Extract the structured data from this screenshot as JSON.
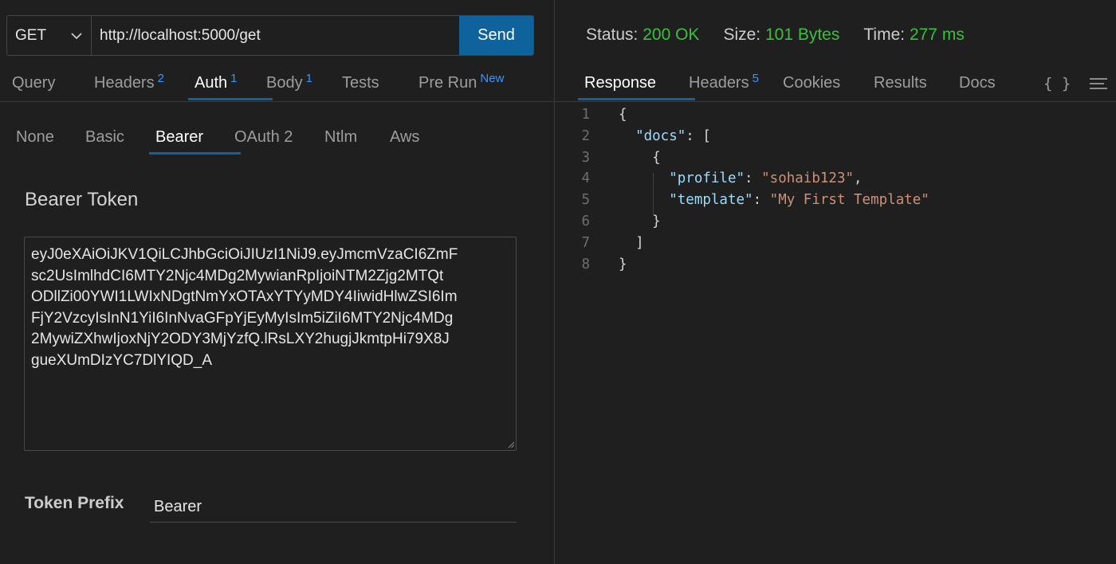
{
  "request": {
    "method": "GET",
    "url": "http://localhost:5000/get",
    "send_label": "Send"
  },
  "request_tabs": [
    {
      "label": "Query",
      "badge": ""
    },
    {
      "label": "Headers",
      "badge": "2"
    },
    {
      "label": "Auth",
      "badge": "1"
    },
    {
      "label": "Body",
      "badge": "1"
    },
    {
      "label": "Tests",
      "badge": ""
    },
    {
      "label": "Pre Run",
      "badge": "New"
    }
  ],
  "auth_tabs": [
    "None",
    "Basic",
    "Bearer",
    "OAuth 2",
    "Ntlm",
    "Aws"
  ],
  "auth": {
    "section_title": "Bearer Token",
    "token": "eyJ0eXAiOiJKV1QiLCJhbGciOiJIUzI1NiJ9.eyJmcmVzaCI6ZmFsc2UsImlhdCI6MTY2Njc4MDg2MywianRpIjoiNTM2Zjg2MTQtODllZi00YWI1LWIxNDgtNmYxOTAxYTYyMDY4IiwidHlwZSI6ImFjY2VzcyIsInN1YiI6InNvaGFpYjEyMyIsIm5iZiI6MTY2Njc4MDg2MywiZXhwIjoxNjY2ODY3MjYzfQ.lRsLXY2hugjJkmtpHi79X8JgueXUmDIzYC7DlYIQD_A",
    "token_lines": [
      "eyJ0eXAiOiJKV1QiLCJhbGciOiJIUzI1NiJ9.eyJmcmVzaCI6ZmF",
      "sc2UsImlhdCI6MTY2Njc4MDg2MywianRpIjoiNTM2Zjg2MTQt",
      "ODllZi00YWI1LWIxNDgtNmYxOTAxYTYyMDY4IiwidHlwZSI6Im",
      "FjY2VzcyIsInN1YiI6InNvaGFpYjEyMyIsIm5iZiI6MTY2Njc4MDg",
      "2MywiZXhwIjoxNjY2ODY3MjYzfQ.lRsLXY2hugjJkmtpHi79X8J",
      "gueXUmDIzYC7DlYIQD_A"
    ],
    "prefix_label": "Token Prefix",
    "prefix_value": "Bearer"
  },
  "response_status": {
    "status_label": "Status:",
    "status_value": "200 OK",
    "size_label": "Size:",
    "size_value": "101 Bytes",
    "time_label": "Time:",
    "time_value": "277 ms",
    "status_color": "#39c139"
  },
  "response_tabs": [
    {
      "label": "Response",
      "badge": ""
    },
    {
      "label": "Headers",
      "badge": "5"
    },
    {
      "label": "Cookies",
      "badge": ""
    },
    {
      "label": "Results",
      "badge": ""
    },
    {
      "label": "Docs",
      "badge": ""
    }
  ],
  "response_icons": {
    "braces": "{ }",
    "menu": "menu-icon"
  },
  "response_body": [
    {
      "n": "1",
      "parts": [
        [
          "p",
          "{"
        ]
      ]
    },
    {
      "n": "2",
      "parts": [
        [
          "p",
          "  "
        ],
        [
          "k",
          "\"docs\""
        ],
        [
          "p",
          ": ["
        ]
      ]
    },
    {
      "n": "3",
      "parts": [
        [
          "p",
          "    {"
        ]
      ]
    },
    {
      "n": "4",
      "parts": [
        [
          "p",
          "      "
        ],
        [
          "k",
          "\"profile\""
        ],
        [
          "p",
          ": "
        ],
        [
          "s",
          "\"sohaib123\""
        ],
        [
          "p",
          ","
        ]
      ]
    },
    {
      "n": "5",
      "parts": [
        [
          "p",
          "      "
        ],
        [
          "k",
          "\"template\""
        ],
        [
          "p",
          ": "
        ],
        [
          "s",
          "\"My First Template\""
        ]
      ]
    },
    {
      "n": "6",
      "parts": [
        [
          "p",
          "    }"
        ]
      ]
    },
    {
      "n": "7",
      "parts": [
        [
          "p",
          "  ]"
        ]
      ]
    },
    {
      "n": "8",
      "parts": [
        [
          "p",
          "}"
        ]
      ]
    }
  ],
  "colors": {
    "accent": "#0e639c",
    "badge": "#3794ff",
    "json_key": "#9cdcfe",
    "json_string": "#ce9178"
  }
}
